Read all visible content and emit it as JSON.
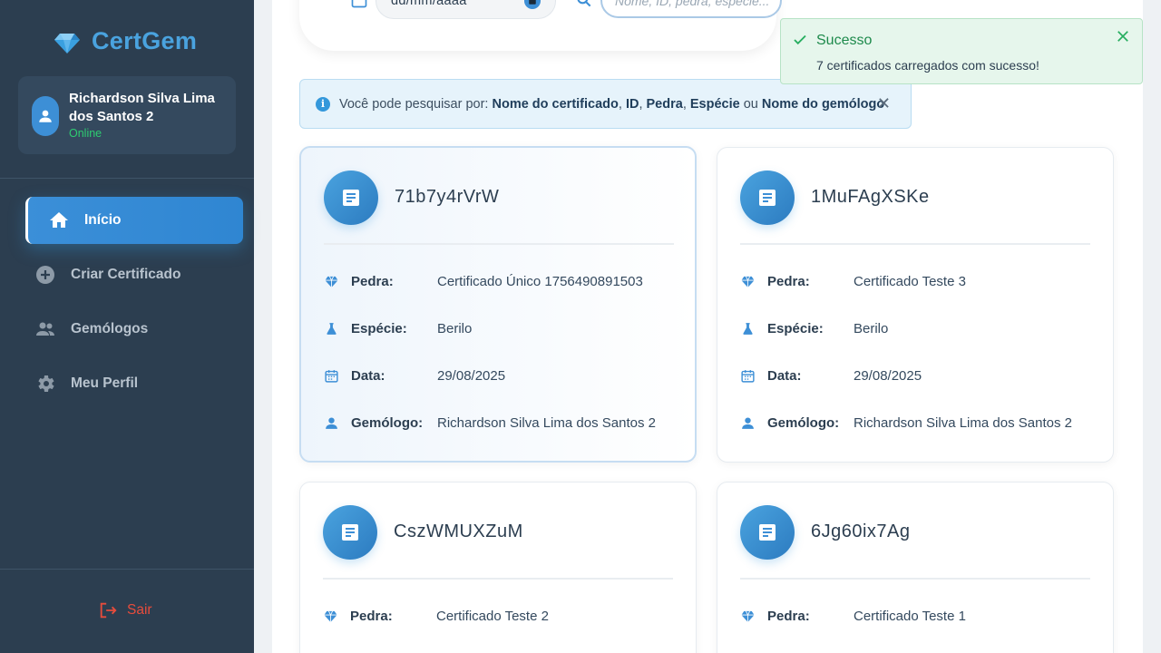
{
  "brand": {
    "name": "CertGem"
  },
  "user": {
    "name": "Richardson Silva Lima dos Santos 2",
    "status": "Online"
  },
  "nav": {
    "items": [
      {
        "label": "Início",
        "icon": "home-icon",
        "active": true
      },
      {
        "label": "Criar Certificado",
        "icon": "plus-circle-icon",
        "active": false
      },
      {
        "label": "Gemólogos",
        "icon": "people-icon",
        "active": false
      },
      {
        "label": "Meu Perfil",
        "icon": "gear-icon",
        "active": false
      }
    ],
    "logout_label": "Sair"
  },
  "filters": {
    "date_placeholder": "dd/mm/aaaa",
    "search_placeholder": "Nome, ID, pedra, espécie..."
  },
  "info": {
    "prefix": "Você pode pesquisar por: ",
    "fields": [
      "Nome do certificado",
      "ID",
      "Pedra",
      "Espécie",
      "Nome do gemólogo"
    ],
    "sep1": ", ",
    "sep_or": " ou "
  },
  "labels": {
    "pedra": "Pedra:",
    "especie": "Espécie:",
    "data": "Data:",
    "gemologo": "Gemólogo:"
  },
  "cards": [
    {
      "id": "71b7y4rVrW",
      "pedra": "Certificado Único 1756490891503",
      "especie": "Berilo",
      "data": "29/08/2025",
      "gemologo": "Richardson Silva Lima dos Santos 2"
    },
    {
      "id": "1MuFAgXSKe",
      "pedra": "Certificado Teste 3",
      "especie": "Berilo",
      "data": "29/08/2025",
      "gemologo": "Richardson Silva Lima dos Santos 2"
    },
    {
      "id": "CszWMUXZuM",
      "pedra": "Certificado Teste 2"
    },
    {
      "id": "6Jg60ix7Ag",
      "pedra": "Certificado Teste 1"
    }
  ],
  "toast": {
    "title": "Sucesso",
    "message": "7 certificados carregados com sucesso!"
  },
  "colors": {
    "sidebar": "#2c3e50",
    "accent": "#3498db",
    "success": "#27ae60",
    "danger": "#e74c3c"
  }
}
